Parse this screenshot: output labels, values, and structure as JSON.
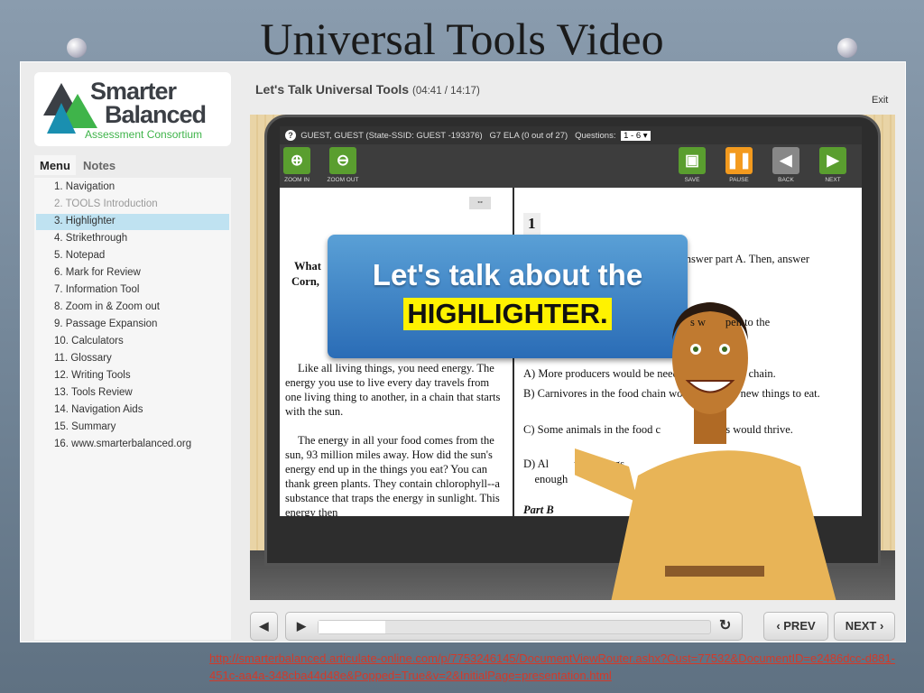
{
  "slide": {
    "title": "Universal Tools Video",
    "link": "http://smarterbalanced.articulate-online.com/p/7753246145/DocumentViewRouter.ashx?Cust=77532&DocumentID=e2486dcc-d881-451c-aa4a-348cba44d48e&Popped=True&v=2&InitialPage=presentation.html"
  },
  "player": {
    "logo": {
      "line1": "Smarter",
      "line2": "Balanced",
      "line3": "Assessment Consortium"
    },
    "tabs": [
      "Menu",
      "Notes"
    ],
    "menu": [
      "1. Navigation",
      "2. TOOLS Introduction",
      "3. Highlighter",
      "4. Strikethrough",
      "5. Notepad",
      "6. Mark for Review",
      "7. Information Tool",
      "8. Zoom in & Zoom out",
      "9. Passage Expansion",
      "10. Calculators",
      "11. Glossary",
      "12. Writing Tools",
      "13. Tools Review",
      "14. Navigation Aids",
      "15. Summary",
      "16. www.smarterbalanced.org"
    ],
    "selected_index": 2,
    "header": {
      "title": "Let's Talk Universal Tools",
      "time": "(04:41 / 14:17)",
      "exit": "Exit"
    },
    "controls": {
      "prev": "PREV",
      "next": "NEXT",
      "progress_percent": 17
    }
  },
  "video": {
    "info": {
      "user": "GUEST, GUEST (State-SSID: GUEST -193376)",
      "test": "G7 ELA (0 out of 27)",
      "questions_label": "Questions:",
      "questions_value": "1 - 6"
    },
    "tools": {
      "zoom_in": "ZOOM IN",
      "zoom_out": "ZOOM OUT",
      "save": "SAVE",
      "pause": "PAUSE",
      "back": "BACK",
      "next": "NEXT"
    },
    "passage": {
      "q1": "What",
      "q2": "Corn,",
      "p1": "Like all living things, you need energy. The energy you use to live every day travels from one living thing to another, in a chain that starts with the sun.",
      "p2": "The energy in all your food comes from the sun, 93 million miles away. How did the sun's energy end up in the things you eat? You can thank green plants. They contain chlorophyll--a substance that traps the energy in sunlight. This energy then"
    },
    "question": {
      "number": "1",
      "intro": ", answer part A. Then, answer",
      "fragment": "s w       pen to the",
      "a": "More producers would be neede          ne food chain.",
      "b": "Carnivores in the food chain woul          find new things to eat.",
      "c": "Some animals in the food c                    ers would thrive.",
      "d": "Al         ving things",
      "d2": "enough",
      "partb": "Part B"
    },
    "bubble": {
      "line1": "Let's talk about the",
      "line2": "HIGHLIGHTER."
    }
  },
  "colors": {
    "accent_green": "#5a9e2f",
    "pause_orange": "#f39a1e",
    "highlight_yellow": "#fff200",
    "bubble_blue": "#2a6cb6",
    "link_red": "#d23a2a"
  }
}
